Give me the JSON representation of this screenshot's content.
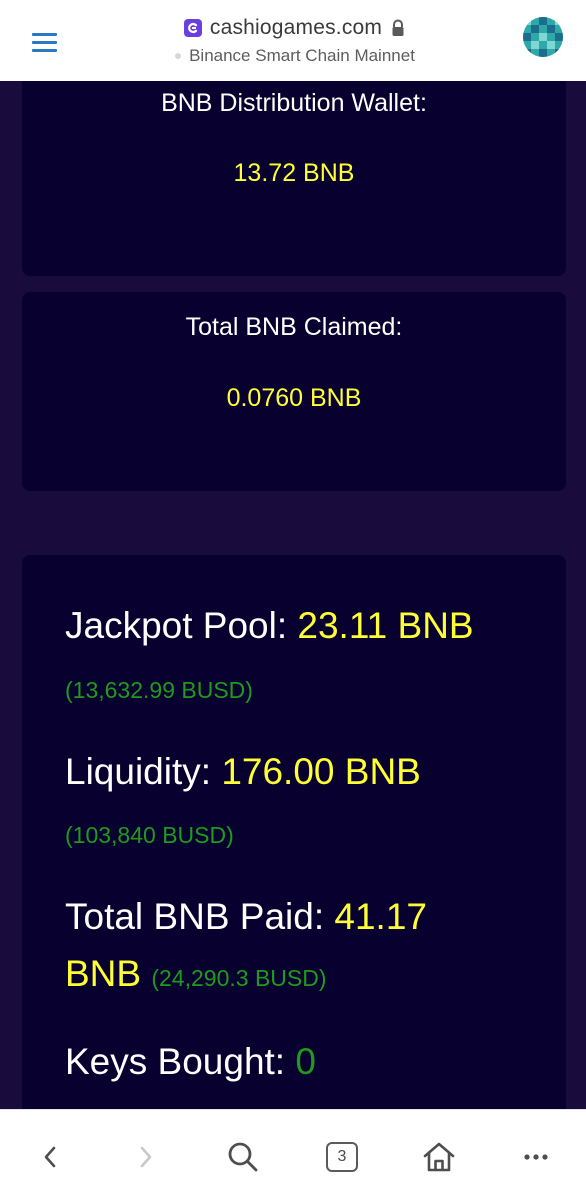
{
  "browser": {
    "url": "cashiogames.com",
    "network": "Binance Smart Chain Mainnet"
  },
  "distribution_wallet": {
    "label": "BNB Distribution Wallet:",
    "value": "13.72 BNB"
  },
  "total_claimed": {
    "label": "Total BNB Claimed:",
    "value": "0.0760 BNB"
  },
  "stats": {
    "jackpot": {
      "label": "Jackpot Pool: ",
      "value": "23.11 BNB",
      "busd": "(13,632.99 BUSD)"
    },
    "liquidity": {
      "label": "Liquidity: ",
      "value": "176.00 BNB",
      "busd": "(103,840 BUSD)"
    },
    "total_paid": {
      "label": "Total BNB Paid: ",
      "value_line1": "41.17",
      "value_line2": "BNB",
      "busd": "(24,290.3 BUSD)"
    },
    "keys": {
      "label": "Keys Bought: ",
      "value": "0"
    }
  },
  "bottom_nav": {
    "tab_count": "3"
  },
  "colors": {
    "page_bg": "#1a0b3d",
    "card_bg": "#08002e",
    "accent_yellow": "#ffff35",
    "accent_green": "#1f9a1c",
    "menu_blue": "#2d78c4"
  },
  "icons": {
    "menu": "hamburger-menu-icon",
    "site_logo": "cashio-logo-icon",
    "lock": "lock-icon",
    "avatar": "account-avatar-icon",
    "back": "chevron-left-icon",
    "forward": "chevron-right-icon",
    "search": "search-icon",
    "tabs": "tabs-icon",
    "home": "home-icon",
    "more": "more-dots-icon"
  }
}
